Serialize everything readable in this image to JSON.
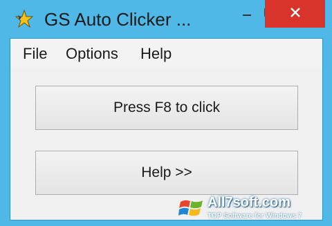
{
  "window": {
    "title": "GS Auto Clicker ...",
    "icon": "star-icon",
    "controls": [
      "minimize-icon",
      "maximize-icon",
      "close-icon"
    ],
    "colors": {
      "frame": "#4fb8e6",
      "close": "#d9342b"
    }
  },
  "menu": {
    "items": [
      {
        "label": "File"
      },
      {
        "label": "Options"
      },
      {
        "label": "Help"
      }
    ]
  },
  "buttons": {
    "press": "Press F8 to click",
    "help": "Help >>"
  },
  "watermark": {
    "site": "All7soft.com",
    "tagline": "TOP Software for Windows 7",
    "logo": "windows-logo-icon"
  }
}
